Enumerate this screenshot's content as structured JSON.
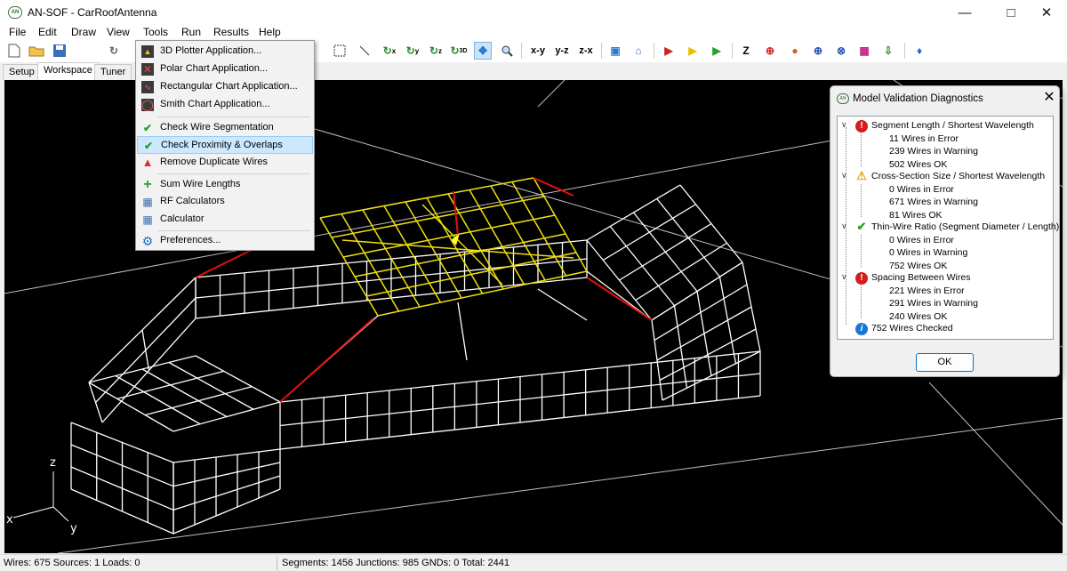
{
  "window": {
    "title": "AN-SOF - CarRoofAntenna",
    "app_icon": "an-sof-logo-icon"
  },
  "menubar": [
    "File",
    "Edit",
    "Draw",
    "View",
    "Tools",
    "Run",
    "Results",
    "Help"
  ],
  "toolbar": {
    "axis_labels": [
      "x",
      "y",
      "z",
      "3D"
    ],
    "plane_labels": [
      "x-y",
      "y-z",
      "z-x"
    ]
  },
  "tabs": [
    "Setup",
    "Workspace",
    "Tuner"
  ],
  "tools_menu": [
    {
      "label": "3D Plotter Application...",
      "icon": "3d-plot-icon"
    },
    {
      "label": "Polar Chart Application...",
      "icon": "polar-chart-icon"
    },
    {
      "label": "Rectangular Chart Application...",
      "icon": "rect-chart-icon"
    },
    {
      "label": "Smith Chart Application...",
      "icon": "smith-chart-icon"
    },
    {
      "label": "Check Wire Segmentation",
      "icon": "check-icon"
    },
    {
      "label": "Check Proximity & Overlaps",
      "icon": "check-icon"
    },
    {
      "label": "Remove Duplicate Wires",
      "icon": "warning-icon"
    },
    {
      "label": "Sum Wire Lengths",
      "icon": "plus-icon"
    },
    {
      "label": "RF Calculators",
      "icon": "rf-calc-icon"
    },
    {
      "label": "Calculator",
      "icon": "calculator-icon"
    },
    {
      "label": "Preferences...",
      "icon": "gear-icon"
    }
  ],
  "axes": {
    "z": "z",
    "x": "x",
    "y": "y"
  },
  "dialog": {
    "title": "Model Validation Diagnostics",
    "groups": [
      {
        "label": "Segment Length / Shortest Wavelength",
        "status": "error",
        "items": [
          "11 Wires in Error",
          "239 Wires in Warning",
          "502 Wires OK"
        ]
      },
      {
        "label": "Cross-Section Size / Shortest Wavelength",
        "status": "warning",
        "items": [
          "0 Wires in Error",
          "671 Wires in Warning",
          "81 Wires OK"
        ]
      },
      {
        "label": "Thin-Wire Ratio (Segment Diameter / Length)",
        "status": "ok",
        "items": [
          "0 Wires in Error",
          "0 Wires in Warning",
          "752 Wires OK"
        ]
      },
      {
        "label": "Spacing Between Wires",
        "status": "error",
        "items": [
          "221 Wires in Error",
          "291 Wires in Warning",
          "240 Wires OK"
        ]
      }
    ],
    "summary": "752 Wires Checked",
    "ok_label": "OK"
  },
  "status": {
    "left": "Wires: 675  Sources: 1  Loads: 0",
    "right": "Segments: 1456  Junctions: 985  GNDs: 0  Total: 2441"
  },
  "colors": {
    "wire": "#ffffff",
    "selected": "#f0e010",
    "source": "#e01010",
    "background": "#000000"
  }
}
